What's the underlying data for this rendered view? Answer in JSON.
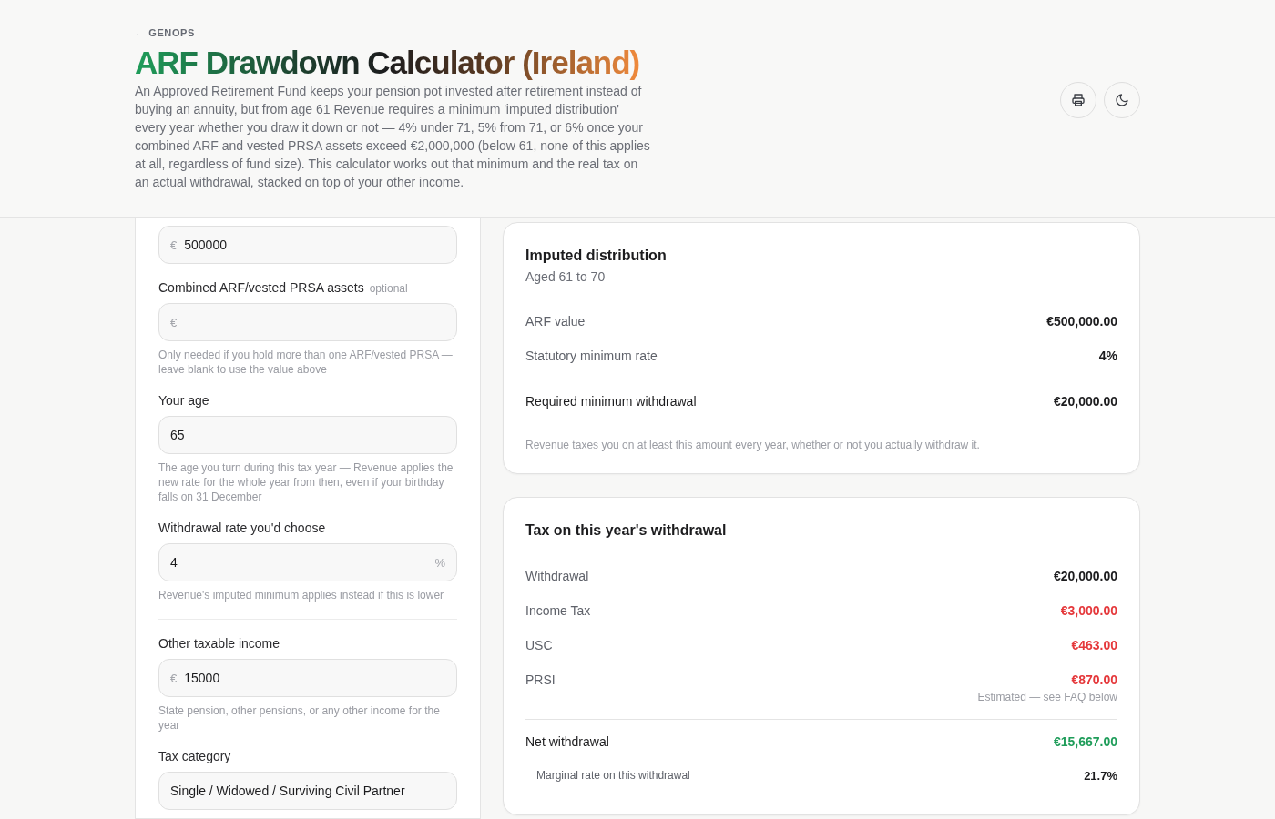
{
  "header": {
    "back_link": "← GENOPS",
    "title": "ARF Drawdown Calculator (Ireland)",
    "description": "An Approved Retirement Fund keeps your pension pot invested after retirement instead of buying an annuity, but from age 61 Revenue requires a minimum 'imputed distribution' every year whether you draw it down or not — 4% under 71, 5% from 71, or 6% once your combined ARF and vested PRSA assets exceed €2,000,000 (below 61, none of this applies at all, regardless of fund size). This calculator works out that minimum and the real tax on an actual withdrawal, stacked on top of your other income.",
    "actions": [
      {
        "kind": "print"
      },
      {
        "kind": "theme"
      }
    ]
  },
  "form": {
    "groups": [
      {
        "fields": [
          {
            "prefix": "€",
            "value": "500000"
          },
          {
            "label": "Combined ARF/vested PRSA assets",
            "tag": "optional",
            "prefix": "€",
            "hint": "Only needed if you hold more than one ARF/vested PRSA — leave blank to use the value above"
          },
          {
            "label": "Your age",
            "value": "65",
            "hint": "The age you turn during this tax year — Revenue applies the new rate for the whole year from then, even if your birthday falls on 31 December"
          },
          {
            "label": "Withdrawal rate you'd choose",
            "value": "4",
            "suffix": "%",
            "hint": "Revenue's imputed minimum applies instead if this is lower"
          }
        ]
      },
      {
        "fields": [
          {
            "label": "Other taxable income",
            "prefix": "€",
            "value": "15000",
            "hint": "State pension, other pensions, or any other income for the year"
          },
          {
            "label": "Tax category",
            "value": "Single / Widowed / Surviving Civil Partner"
          }
        ]
      }
    ]
  },
  "cards": [
    {
      "title": "Imputed distribution",
      "subtitle": "Aged 61 to 70",
      "rows": [
        {
          "kind": "row",
          "label": "ARF value",
          "value": "€500,000.00",
          "color": "#1c1c1e"
        },
        {
          "kind": "row",
          "label": "Statutory minimum rate",
          "value": "4%",
          "color": "#1c1c1e"
        },
        {
          "kind": "total",
          "label": "Required minimum withdrawal",
          "value": "€20,000.00",
          "color": "#1c1c1e"
        }
      ],
      "note": "Revenue taxes you on at least this amount every year, whether or not you actually withdraw it."
    },
    {
      "title": "Tax on this year's withdrawal",
      "rows": [
        {
          "kind": "row",
          "label": "Withdrawal",
          "value": "€20,000.00",
          "color": "#1c1c1e"
        },
        {
          "kind": "row",
          "label": "Income Tax",
          "value": "€3,000.00",
          "color": "#e5383b"
        },
        {
          "kind": "row",
          "label": "USC",
          "value": "€463.00",
          "color": "#e5383b"
        },
        {
          "kind": "row",
          "label": "PRSI",
          "value": "€870.00",
          "color": "#e5383b",
          "detail": "Estimated — see FAQ below"
        },
        {
          "kind": "total",
          "label": "Net withdrawal",
          "value": "€15,667.00",
          "color": "#1f9d5a"
        },
        {
          "kind": "sub",
          "label": "Marginal rate on this withdrawal",
          "value": "21.7%",
          "color": "#1c1c1e"
        }
      ]
    }
  ]
}
